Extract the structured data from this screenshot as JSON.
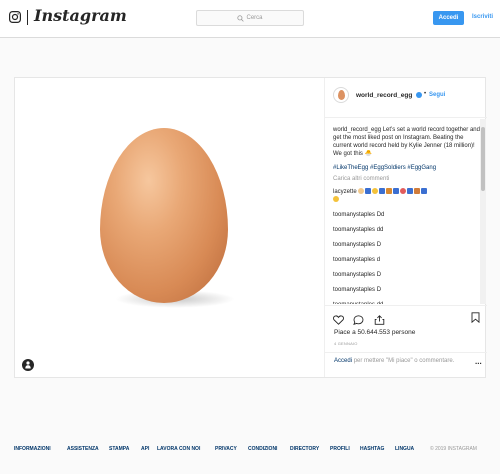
{
  "header": {
    "wordmark": "Instagram",
    "search_placeholder": "Cerca",
    "login_label": "Accedi",
    "signup_label": "Iscriviti"
  },
  "post": {
    "username": "world_record_egg",
    "follow_label": "Segui",
    "separator": "•",
    "caption_user": "world_record_egg",
    "caption_text": "Let’s set a world record together and get the most liked post on Instagram. Beating the current world record held by Kylie Jenner (18 million)! We got this 🐣",
    "hashtags": "#LikeTheEgg #EggSoldiers #EggGang",
    "load_more": "Carica altri commenti",
    "comments": [
      {
        "user": "lacyzette",
        "text": ""
      },
      {
        "user": "toomanystaples",
        "text": "Dd"
      },
      {
        "user": "toomanystaples",
        "text": "dd"
      },
      {
        "user": "toomanystaples",
        "text": "D"
      },
      {
        "user": "toomanystaples",
        "text": "d"
      },
      {
        "user": "toomanystaples",
        "text": "D"
      },
      {
        "user": "toomanystaples",
        "text": "D"
      },
      {
        "user": "toomanystaples",
        "text": "dd"
      }
    ],
    "likes_text": "Piace a 50.644.553 persone",
    "date": "4 GENNAIO",
    "login_link": "Accedi",
    "login_prompt_rest": "per mettere \"Mi piace\" o commentare.",
    "more_options": "..."
  },
  "footer": {
    "links": [
      "INFORMAZIONI",
      "ASSISTENZA",
      "STAMPA",
      "API",
      "LAVORA CON NOI",
      "PRIVACY",
      "CONDIZIONI",
      "DIRECTORY",
      "PROFILI",
      "HASHTAG",
      "LINGUA"
    ],
    "copyright": "© 2019 INSTAGRAM"
  },
  "colors": {
    "accent": "#3897f0",
    "link_dark": "#003569",
    "muted": "#999999"
  }
}
